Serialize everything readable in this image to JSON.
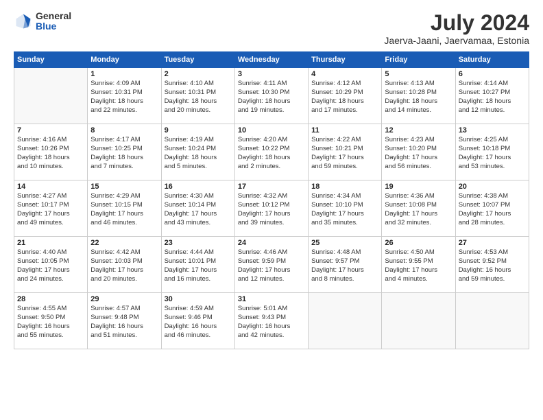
{
  "logo": {
    "general": "General",
    "blue": "Blue"
  },
  "title": "July 2024",
  "subtitle": "Jaerva-Jaani, Jaervamaa, Estonia",
  "headers": [
    "Sunday",
    "Monday",
    "Tuesday",
    "Wednesday",
    "Thursday",
    "Friday",
    "Saturday"
  ],
  "weeks": [
    [
      {
        "num": "",
        "info": ""
      },
      {
        "num": "1",
        "info": "Sunrise: 4:09 AM\nSunset: 10:31 PM\nDaylight: 18 hours\nand 22 minutes."
      },
      {
        "num": "2",
        "info": "Sunrise: 4:10 AM\nSunset: 10:31 PM\nDaylight: 18 hours\nand 20 minutes."
      },
      {
        "num": "3",
        "info": "Sunrise: 4:11 AM\nSunset: 10:30 PM\nDaylight: 18 hours\nand 19 minutes."
      },
      {
        "num": "4",
        "info": "Sunrise: 4:12 AM\nSunset: 10:29 PM\nDaylight: 18 hours\nand 17 minutes."
      },
      {
        "num": "5",
        "info": "Sunrise: 4:13 AM\nSunset: 10:28 PM\nDaylight: 18 hours\nand 14 minutes."
      },
      {
        "num": "6",
        "info": "Sunrise: 4:14 AM\nSunset: 10:27 PM\nDaylight: 18 hours\nand 12 minutes."
      }
    ],
    [
      {
        "num": "7",
        "info": "Sunrise: 4:16 AM\nSunset: 10:26 PM\nDaylight: 18 hours\nand 10 minutes."
      },
      {
        "num": "8",
        "info": "Sunrise: 4:17 AM\nSunset: 10:25 PM\nDaylight: 18 hours\nand 7 minutes."
      },
      {
        "num": "9",
        "info": "Sunrise: 4:19 AM\nSunset: 10:24 PM\nDaylight: 18 hours\nand 5 minutes."
      },
      {
        "num": "10",
        "info": "Sunrise: 4:20 AM\nSunset: 10:22 PM\nDaylight: 18 hours\nand 2 minutes."
      },
      {
        "num": "11",
        "info": "Sunrise: 4:22 AM\nSunset: 10:21 PM\nDaylight: 17 hours\nand 59 minutes."
      },
      {
        "num": "12",
        "info": "Sunrise: 4:23 AM\nSunset: 10:20 PM\nDaylight: 17 hours\nand 56 minutes."
      },
      {
        "num": "13",
        "info": "Sunrise: 4:25 AM\nSunset: 10:18 PM\nDaylight: 17 hours\nand 53 minutes."
      }
    ],
    [
      {
        "num": "14",
        "info": "Sunrise: 4:27 AM\nSunset: 10:17 PM\nDaylight: 17 hours\nand 49 minutes."
      },
      {
        "num": "15",
        "info": "Sunrise: 4:29 AM\nSunset: 10:15 PM\nDaylight: 17 hours\nand 46 minutes."
      },
      {
        "num": "16",
        "info": "Sunrise: 4:30 AM\nSunset: 10:14 PM\nDaylight: 17 hours\nand 43 minutes."
      },
      {
        "num": "17",
        "info": "Sunrise: 4:32 AM\nSunset: 10:12 PM\nDaylight: 17 hours\nand 39 minutes."
      },
      {
        "num": "18",
        "info": "Sunrise: 4:34 AM\nSunset: 10:10 PM\nDaylight: 17 hours\nand 35 minutes."
      },
      {
        "num": "19",
        "info": "Sunrise: 4:36 AM\nSunset: 10:08 PM\nDaylight: 17 hours\nand 32 minutes."
      },
      {
        "num": "20",
        "info": "Sunrise: 4:38 AM\nSunset: 10:07 PM\nDaylight: 17 hours\nand 28 minutes."
      }
    ],
    [
      {
        "num": "21",
        "info": "Sunrise: 4:40 AM\nSunset: 10:05 PM\nDaylight: 17 hours\nand 24 minutes."
      },
      {
        "num": "22",
        "info": "Sunrise: 4:42 AM\nSunset: 10:03 PM\nDaylight: 17 hours\nand 20 minutes."
      },
      {
        "num": "23",
        "info": "Sunrise: 4:44 AM\nSunset: 10:01 PM\nDaylight: 17 hours\nand 16 minutes."
      },
      {
        "num": "24",
        "info": "Sunrise: 4:46 AM\nSunset: 9:59 PM\nDaylight: 17 hours\nand 12 minutes."
      },
      {
        "num": "25",
        "info": "Sunrise: 4:48 AM\nSunset: 9:57 PM\nDaylight: 17 hours\nand 8 minutes."
      },
      {
        "num": "26",
        "info": "Sunrise: 4:50 AM\nSunset: 9:55 PM\nDaylight: 17 hours\nand 4 minutes."
      },
      {
        "num": "27",
        "info": "Sunrise: 4:53 AM\nSunset: 9:52 PM\nDaylight: 16 hours\nand 59 minutes."
      }
    ],
    [
      {
        "num": "28",
        "info": "Sunrise: 4:55 AM\nSunset: 9:50 PM\nDaylight: 16 hours\nand 55 minutes."
      },
      {
        "num": "29",
        "info": "Sunrise: 4:57 AM\nSunset: 9:48 PM\nDaylight: 16 hours\nand 51 minutes."
      },
      {
        "num": "30",
        "info": "Sunrise: 4:59 AM\nSunset: 9:46 PM\nDaylight: 16 hours\nand 46 minutes."
      },
      {
        "num": "31",
        "info": "Sunrise: 5:01 AM\nSunset: 9:43 PM\nDaylight: 16 hours\nand 42 minutes."
      },
      {
        "num": "",
        "info": ""
      },
      {
        "num": "",
        "info": ""
      },
      {
        "num": "",
        "info": ""
      }
    ]
  ]
}
